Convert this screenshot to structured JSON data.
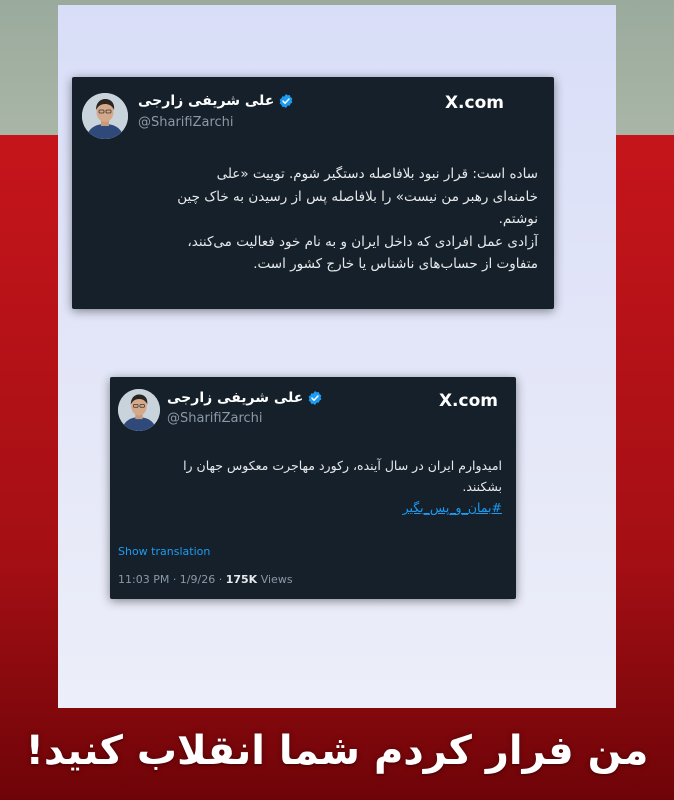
{
  "tweets": [
    {
      "author_name": "علی شریفی زارجی",
      "handle": "@SharifiZarchi",
      "brand": "X.com",
      "lines": [
        "ساده است: قرار نبود بلافاصله دستگیر شوم. توییت «علی",
        "خامنه‌ای رهبر من نیست» را بلافاصله پس از رسیدن به خاک چین",
        "نوشتم.",
        "آزادی عمل افرادی که داخل ایران و به نام خود فعالیت می‌کنند،",
        "متفاوت از حساب‌های ناشناس یا خارج کشور است."
      ]
    },
    {
      "author_name": "علی شریفی زارجی",
      "handle": "@SharifiZarchi",
      "brand": "X.com",
      "lines": [
        "امیدوارم ایران در سال آینده، رکورد مهاجرت معکوس جهان را",
        "بشکنند."
      ],
      "hashtag": "#بمان_و_پس_بگیر",
      "show_translation": "Show translation",
      "time_date": "11:03 PM · 1/9/26 · ",
      "views_count": "175K",
      "views_label": " Views"
    }
  ],
  "headline": "من فرار کردم شما انقلاب کنید!",
  "colors": {
    "tweet_bg": "#15202b",
    "link": "#1d9bf0",
    "verified": "#1d9bf0",
    "banner_red": "#c5151b"
  },
  "icons": {
    "verified": "verified-badge-icon",
    "x_logo": "x-logo-icon",
    "avatar": "user-avatar-photo"
  }
}
